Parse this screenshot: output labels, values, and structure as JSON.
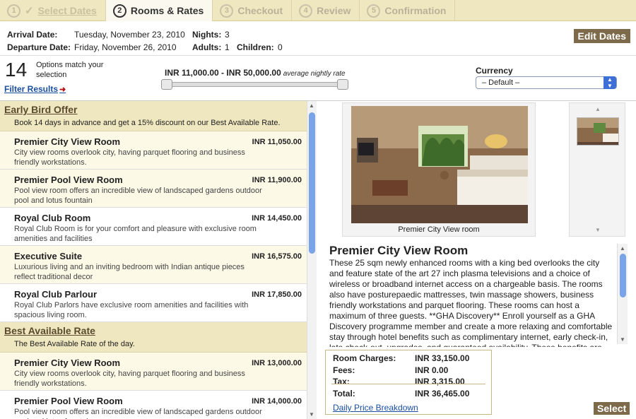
{
  "steps": [
    {
      "num": "1",
      "label": "Select Dates"
    },
    {
      "num": "2",
      "label": "Rooms & Rates"
    },
    {
      "num": "3",
      "label": "Checkout"
    },
    {
      "num": "4",
      "label": "Review"
    },
    {
      "num": "5",
      "label": "Confirmation"
    }
  ],
  "stay": {
    "arrival_label": "Arrival Date:",
    "arrival": "Tuesday, November 23, 2010",
    "departure_label": "Departure Date:",
    "departure": "Friday, November 26, 2010",
    "nights_label": "Nights:",
    "nights": "3",
    "adults_label": "Adults:",
    "adults": "1",
    "children_label": "Children:",
    "children": "0",
    "edit_label": "Edit Dates"
  },
  "filter": {
    "count": "14",
    "count_text": "Options match your selection",
    "link": "Filter Results",
    "range": "INR 11,000.00 - INR 50,000.00",
    "range_note": "average nightly rate",
    "currency_label": "Currency",
    "currency_value": "– Default –"
  },
  "groups": [
    {
      "title": "Early Bird Offer",
      "desc": "Book 14 days in advance and get a 15% discount on our Best Available Rate.",
      "rooms": [
        {
          "name": "Premier City View Room",
          "price": "INR 11,050.00",
          "desc": "City view rooms overlook city, having parquet flooring and business friendly workstations."
        },
        {
          "name": "Premier Pool View Room",
          "price": "INR 11,900.00",
          "desc": "Pool view room offers an incredible view of landscaped gardens outdoor pool and lotus fountain"
        },
        {
          "name": "Royal Club Room",
          "price": "INR 14,450.00",
          "desc": "Royal Club Room is for your comfort and pleasure with exclusive room amenities and facilities"
        },
        {
          "name": "Executive Suite",
          "price": "INR 16,575.00",
          "desc": "Luxurious living and an inviting bedroom with Indian antique pieces reflect traditional decor"
        },
        {
          "name": "Royal Club Parlour",
          "price": "INR 17,850.00",
          "desc": "Royal Club Parlors have exclusive room amenities and facilities with spacious living room."
        }
      ]
    },
    {
      "title": "Best Available Rate",
      "desc": "The Best Available Rate of the day.",
      "rooms": [
        {
          "name": "Premier City View Room",
          "price": "INR 13,000.00",
          "desc": "City view rooms overlook city, having parquet flooring and business friendly workstations."
        },
        {
          "name": "Premier Pool View Room",
          "price": "INR 14,000.00",
          "desc": "Pool view room offers an incredible view of landscaped gardens outdoor pool and lotus fountain"
        }
      ]
    }
  ],
  "detail": {
    "caption": "Premier City View room",
    "title": "Premier City View Room",
    "text": "These 25 sqm newly enhanced rooms with a king bed overlooks the city and feature state of the art 27 inch plasma televisions and a choice of wireless or broadband internet access on a chargeable basis. The rooms also have posturepaedic mattresses, twin massage showers, business friendly workstations and parquet flooring. These rooms can host a maximum of three guests. **GHA Discovery** Enroll yourself as a GHA Discovery programme member and create a more relaxing and comfortable stay through hotel benefits such as complimentary internet, early check-in, late check-out, upgrades, and guaranteed availability. These benefits are"
  },
  "charges": {
    "room_label": "Room Charges:",
    "room": "INR 33,150.00",
    "fees_label": "Fees:",
    "fees": "INR 0.00",
    "tax_label": "Tax:",
    "tax": "INR 3,315.00",
    "total_label": "Total:",
    "total": "INR 36,465.00",
    "breakdown": "Daily Price Breakdown"
  },
  "select_label": "Select",
  "colors": {
    "header_bg": "#efe7bf",
    "button_bg": "#7d6a4a",
    "link": "#1a4fa0",
    "scroll": "#7aa3e8"
  }
}
